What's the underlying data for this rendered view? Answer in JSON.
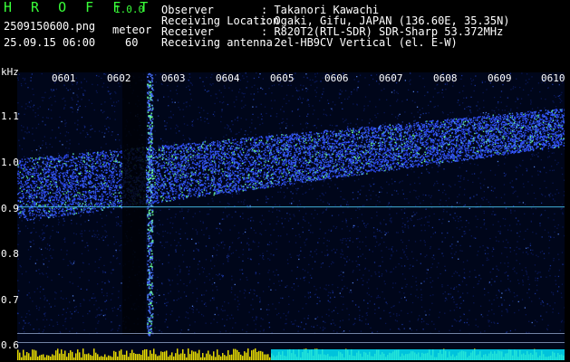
{
  "header": {
    "app_title": "H R O F F T",
    "version": "1.0.0",
    "file_name": "2509150600.png",
    "timestamp": "25.09.15 06:00",
    "mode_label": "meteor",
    "mode_value": "60"
  },
  "info": [
    {
      "key": "Observer",
      "value": ": Takanori Kawachi"
    },
    {
      "key": "Receiving Location",
      "value": ": Ogaki, Gifu, JAPAN (136.60E, 35.35N)"
    },
    {
      "key": "Receiver",
      "value": ": R820T2(RTL-SDR) SDR-Sharp 53.372MHz"
    },
    {
      "key": "Receiving antenna",
      "value": ": 2el-HB9CV Vertical (el. E-W)"
    }
  ],
  "axis": {
    "y_unit": "kHz",
    "x_ticks": [
      "0601",
      "0602",
      "0603",
      "0604",
      "0605",
      "0606",
      "0607",
      "0608",
      "0609",
      "0610"
    ],
    "y_ticks": [
      "1.1",
      "1.0",
      "0.9",
      "0.8",
      "0.7",
      "0.6"
    ]
  },
  "colors": {
    "background": "#000000",
    "header_green": "#39ff39",
    "spectrogram_base": "#00061a",
    "signal_green": "#6cff9a",
    "signal_blue": "#2f4dff",
    "level_bar_yellow": "#f2e600",
    "level_bar_cyan": "#00e5ff"
  }
}
